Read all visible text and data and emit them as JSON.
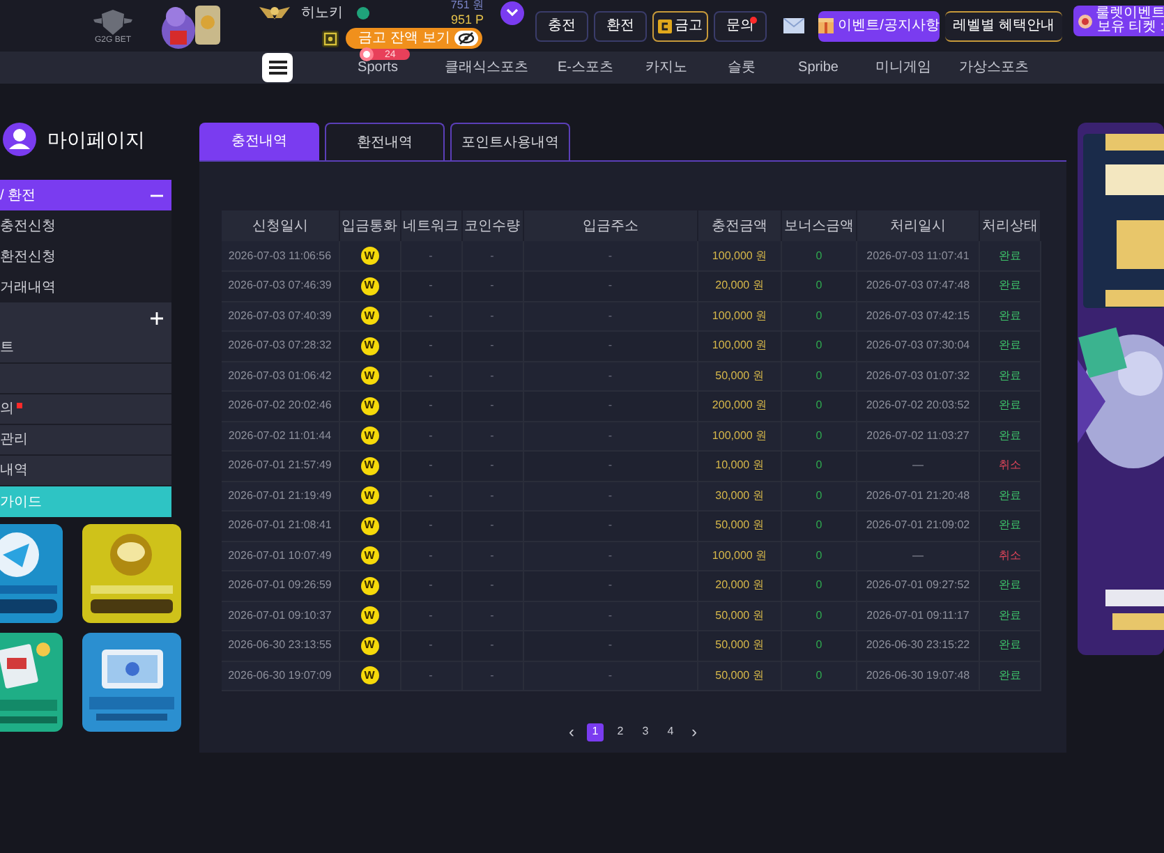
{
  "header": {
    "logo": "G2G BET",
    "username": "히노키",
    "cash": "751 원",
    "points": "951 P",
    "vault_button": "금고 잔액 보기",
    "ticket_badge": "24",
    "buttons": [
      {
        "label": "충전",
        "kind": "plain"
      },
      {
        "label": "환전",
        "kind": "plain"
      },
      {
        "label": "금고",
        "kind": "vault"
      },
      {
        "label": "문의",
        "kind": "alert"
      },
      {
        "label": "이벤트/공지사항",
        "kind": "event"
      },
      {
        "label": "레벨별 혜택안내",
        "kind": "level"
      }
    ],
    "roulette": {
      "title": "룰렛이벤트",
      "subtitle": "보유 티켓 :"
    }
  },
  "nav": [
    "Sports",
    "클래식스포츠",
    "E-스포츠",
    "카지노",
    "슬롯",
    "Spribe",
    "미니게임",
    "가상스포츠"
  ],
  "sidebar": {
    "title": "마이페이지",
    "items": [
      {
        "label": "/ 환전",
        "kind": "group",
        "expanded": true
      },
      {
        "label": "충전신청",
        "kind": "item"
      },
      {
        "label": "환전신청",
        "kind": "item"
      },
      {
        "label": "거래내역",
        "kind": "item"
      },
      {
        "kind": "group",
        "expanded": false
      },
      {
        "label": "트",
        "kind": "link",
        "alert": false
      },
      {
        "kind": "link",
        "alert": false
      },
      {
        "label": "의",
        "kind": "link",
        "alert": true
      },
      {
        "label": "관리",
        "kind": "link",
        "alert": false
      },
      {
        "label": "내역",
        "kind": "link",
        "alert": false
      },
      {
        "label": "가이드",
        "kind": "guide"
      }
    ]
  },
  "tabs": [
    {
      "label": "충전내역",
      "selected": true
    },
    {
      "label": "환전내역",
      "selected": false
    },
    {
      "label": "포인트사용내역",
      "selected": false
    }
  ],
  "table": {
    "columns": [
      "신청일시",
      "입금통화",
      "네트워크",
      "코인수량",
      "입금주소",
      "충전금액",
      "보너스금액",
      "처리일시",
      "처리상태"
    ],
    "rows": [
      {
        "requested": "2026-07-03 11:06:56",
        "currency": "W",
        "network": "-",
        "coins": "-",
        "address": "-",
        "amount": "100,000 원",
        "bonus": "0",
        "processed": "2026-07-03 11:07:41",
        "status": "완료",
        "cancelled": false
      },
      {
        "requested": "2026-07-03 07:46:39",
        "currency": "W",
        "network": "-",
        "coins": "-",
        "address": "-",
        "amount": "20,000 원",
        "bonus": "0",
        "processed": "2026-07-03 07:47:48",
        "status": "완료",
        "cancelled": false
      },
      {
        "requested": "2026-07-03 07:40:39",
        "currency": "W",
        "network": "-",
        "coins": "-",
        "address": "-",
        "amount": "100,000 원",
        "bonus": "0",
        "processed": "2026-07-03 07:42:15",
        "status": "완료",
        "cancelled": false
      },
      {
        "requested": "2026-07-03 07:28:32",
        "currency": "W",
        "network": "-",
        "coins": "-",
        "address": "-",
        "amount": "100,000 원",
        "bonus": "0",
        "processed": "2026-07-03 07:30:04",
        "status": "완료",
        "cancelled": false
      },
      {
        "requested": "2026-07-03 01:06:42",
        "currency": "W",
        "network": "-",
        "coins": "-",
        "address": "-",
        "amount": "50,000 원",
        "bonus": "0",
        "processed": "2026-07-03 01:07:32",
        "status": "완료",
        "cancelled": false
      },
      {
        "requested": "2026-07-02 20:02:46",
        "currency": "W",
        "network": "-",
        "coins": "-",
        "address": "-",
        "amount": "200,000 원",
        "bonus": "0",
        "processed": "2026-07-02 20:03:52",
        "status": "완료",
        "cancelled": false
      },
      {
        "requested": "2026-07-02 11:01:44",
        "currency": "W",
        "network": "-",
        "coins": "-",
        "address": "-",
        "amount": "100,000 원",
        "bonus": "0",
        "processed": "2026-07-02 11:03:27",
        "status": "완료",
        "cancelled": false
      },
      {
        "requested": "2026-07-01 21:57:49",
        "currency": "W",
        "network": "-",
        "coins": "-",
        "address": "-",
        "amount": "10,000 원",
        "bonus": "0",
        "processed": "—",
        "status": "취소",
        "cancelled": true
      },
      {
        "requested": "2026-07-01 21:19:49",
        "currency": "W",
        "network": "-",
        "coins": "-",
        "address": "-",
        "amount": "30,000 원",
        "bonus": "0",
        "processed": "2026-07-01 21:20:48",
        "status": "완료",
        "cancelled": false
      },
      {
        "requested": "2026-07-01 21:08:41",
        "currency": "W",
        "network": "-",
        "coins": "-",
        "address": "-",
        "amount": "50,000 원",
        "bonus": "0",
        "processed": "2026-07-01 21:09:02",
        "status": "완료",
        "cancelled": false
      },
      {
        "requested": "2026-07-01 10:07:49",
        "currency": "W",
        "network": "-",
        "coins": "-",
        "address": "-",
        "amount": "100,000 원",
        "bonus": "0",
        "processed": "—",
        "status": "취소",
        "cancelled": true
      },
      {
        "requested": "2026-07-01 09:26:59",
        "currency": "W",
        "network": "-",
        "coins": "-",
        "address": "-",
        "amount": "20,000 원",
        "bonus": "0",
        "processed": "2026-07-01 09:27:52",
        "status": "완료",
        "cancelled": false
      },
      {
        "requested": "2026-07-01 09:10:37",
        "currency": "W",
        "network": "-",
        "coins": "-",
        "address": "-",
        "amount": "50,000 원",
        "bonus": "0",
        "processed": "2026-07-01 09:11:17",
        "status": "완료",
        "cancelled": false
      },
      {
        "requested": "2026-06-30 23:13:55",
        "currency": "W",
        "network": "-",
        "coins": "-",
        "address": "-",
        "amount": "50,000 원",
        "bonus": "0",
        "processed": "2026-06-30 23:15:22",
        "status": "완료",
        "cancelled": false
      },
      {
        "requested": "2026-06-30 19:07:09",
        "currency": "W",
        "network": "-",
        "coins": "-",
        "address": "-",
        "amount": "50,000 원",
        "bonus": "0",
        "processed": "2026-06-30 19:07:48",
        "status": "완료",
        "cancelled": false
      }
    ]
  },
  "pagination": {
    "prev": "‹",
    "next": "›",
    "pages": [
      {
        "label": "1",
        "selected": true
      },
      {
        "label": "2",
        "selected": false
      },
      {
        "label": "3",
        "selected": false
      },
      {
        "label": "4",
        "selected": false
      }
    ]
  }
}
